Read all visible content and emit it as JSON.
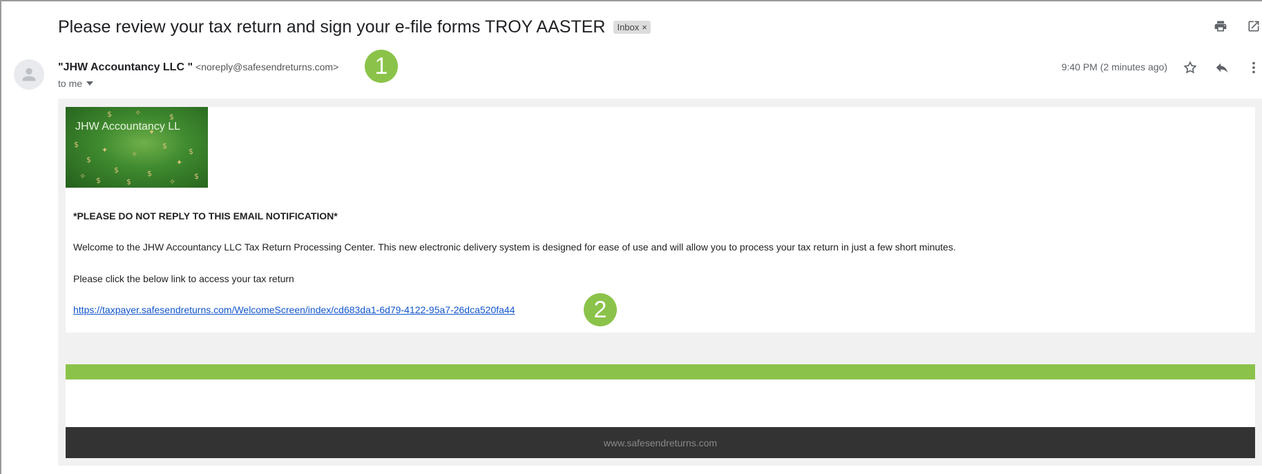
{
  "email": {
    "subject": "Please review your tax return and sign your e-file forms TROY AASTER",
    "label": "Inbox",
    "label_close": "×",
    "sender_name": "\"JHW Accountancy LLC \"",
    "sender_email": "<noreply@safesendreturns.com>",
    "recipient": "to me",
    "time": "9:40 PM (2 minutes ago)"
  },
  "annotations": {
    "badge1": "1",
    "badge2": "2"
  },
  "body": {
    "logo_text": "JHW Accountancy LL",
    "notice": "*PLEASE DO NOT REPLY TO THIS EMAIL NOTIFICATION*",
    "welcome": "Welcome to the JHW Accountancy LLC Tax Return Processing Center. This new electronic delivery system is designed for ease of use and will allow you to process your tax return in just a few short minutes.",
    "click_instruction": "Please click the below link to access your tax return",
    "link": "https://taxpayer.safesendreturns.com/WelcomeScreen/index/cd683da1-6d79-4122-95a7-26dca520fa44",
    "footer": "www.safesendreturns.com"
  },
  "icons": [
    "print-icon",
    "open-in-new-window-icon",
    "star-icon",
    "reply-icon",
    "more-options-icon",
    "avatar-icon",
    "dropdown-arrow-icon"
  ],
  "colors": {
    "accent_green": "#8bc34a",
    "footer_dark": "#333333",
    "link": "#1155cc"
  }
}
